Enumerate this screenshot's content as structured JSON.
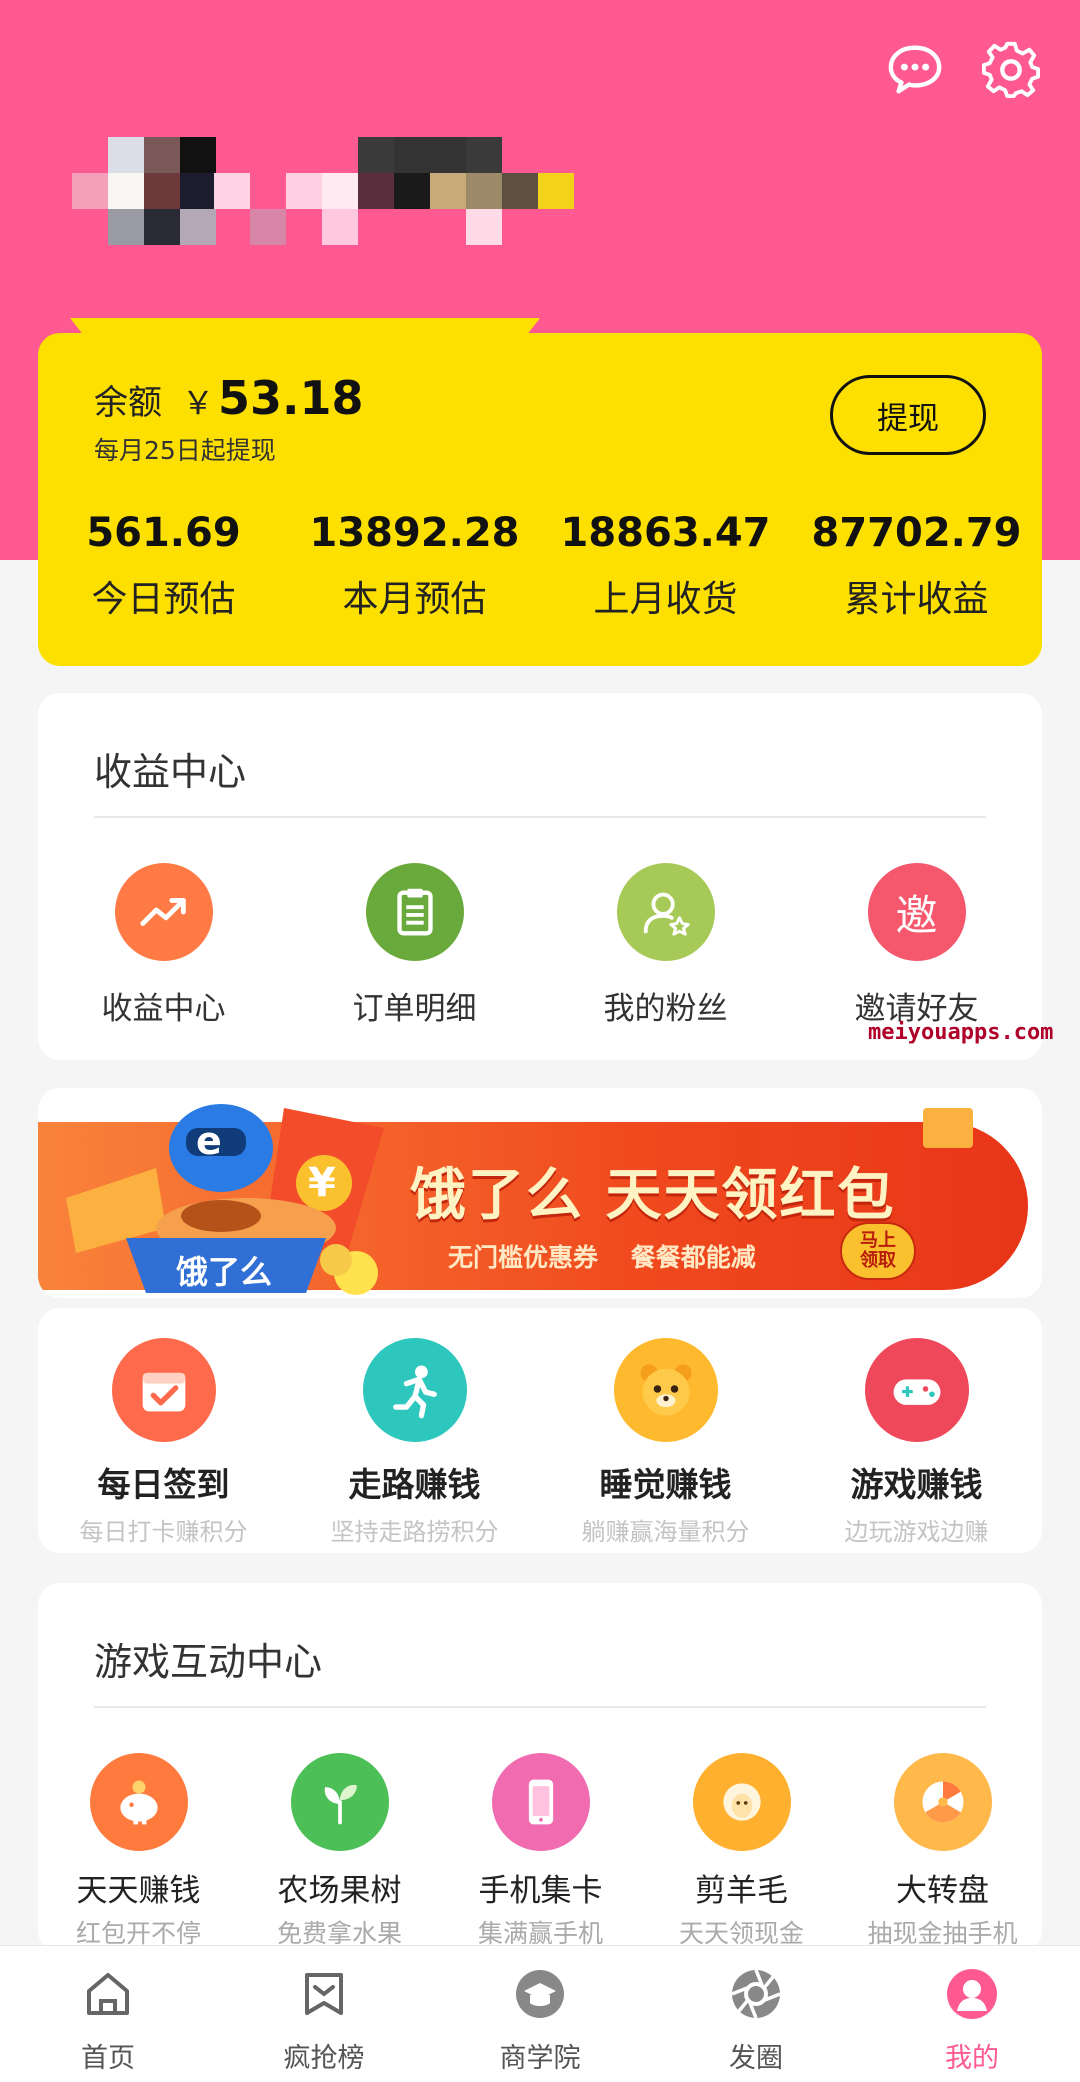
{
  "header": {
    "message_icon": "chat-bubble-icon",
    "settings_icon": "gear-icon",
    "background_color": "#fe5a91"
  },
  "balance": {
    "label": "余额",
    "currency": "￥",
    "value": "53.18",
    "note": "每月25日起提现",
    "withdraw_label": "提现",
    "card_color": "#fde000",
    "stats": [
      {
        "value": "561.69",
        "label": "今日预估"
      },
      {
        "value": "13892.28",
        "label": "本月预估"
      },
      {
        "value": "18863.47",
        "label": "上月收货"
      },
      {
        "value": "87702.79",
        "label": "累计收益"
      }
    ]
  },
  "earnings_center": {
    "title": "收益中心",
    "items": [
      {
        "label": "收益中心",
        "icon": "trend-up-icon",
        "color": "#ff7a45"
      },
      {
        "label": "订单明细",
        "icon": "clipboard-icon",
        "color": "#6aaa3c"
      },
      {
        "label": "我的粉丝",
        "icon": "user-star-icon",
        "color": "#a7c957"
      },
      {
        "label": "邀请好友",
        "icon": "invite-icon",
        "color": "#f5576c",
        "glyph": "邀"
      }
    ]
  },
  "watermark": "meiyouapps.com",
  "banner": {
    "title": "饿了么  天天领红包",
    "subtitle": "无门槛优惠券  餐餐都能减",
    "button_line1": "马上",
    "button_line2": "领取",
    "logo_text": "饿了么",
    "logo_letter": "e"
  },
  "tasks": [
    {
      "title": "每日签到",
      "subtitle": "每日打卡赚积分",
      "icon": "calendar-check-icon",
      "color": "#ff6a4d"
    },
    {
      "title": "走路赚钱",
      "subtitle": "坚持走路捞积分",
      "icon": "running-icon",
      "color": "#2ec7bd"
    },
    {
      "title": "睡觉赚钱",
      "subtitle": "躺赚赢海量积分",
      "icon": "bear-face-icon",
      "color": "#ffb92e"
    },
    {
      "title": "游戏赚钱",
      "subtitle": "边玩游戏边赚",
      "icon": "gamepad-icon",
      "color": "#f0485b"
    }
  ],
  "game_center": {
    "title": "游戏互动中心",
    "items": [
      {
        "title": "天天赚钱",
        "subtitle": "红包开不停",
        "icon": "piggy-bank-icon",
        "color": "#ff7a3d"
      },
      {
        "title": "农场果树",
        "subtitle": "免费拿水果",
        "icon": "sprout-icon",
        "color": "#4cbf56"
      },
      {
        "title": "手机集卡",
        "subtitle": "集满赢手机",
        "icon": "phone-card-icon",
        "color": "#f06bb0"
      },
      {
        "title": "剪羊毛",
        "subtitle": "天天领现金",
        "icon": "sheep-icon",
        "color": "#ffb02e"
      },
      {
        "title": "大转盘",
        "subtitle": "抽现金抽手机",
        "icon": "prize-wheel-icon",
        "color": "#ffb84a"
      }
    ]
  },
  "tabbar": {
    "active_color": "#fe5a91",
    "items": [
      {
        "label": "首页",
        "icon": "home-icon"
      },
      {
        "label": "疯抢榜",
        "icon": "ranking-flag-icon"
      },
      {
        "label": "商学院",
        "icon": "graduation-cap-icon"
      },
      {
        "label": "发圈",
        "icon": "camera-aperture-icon"
      },
      {
        "label": "我的",
        "icon": "profile-icon"
      }
    ]
  }
}
